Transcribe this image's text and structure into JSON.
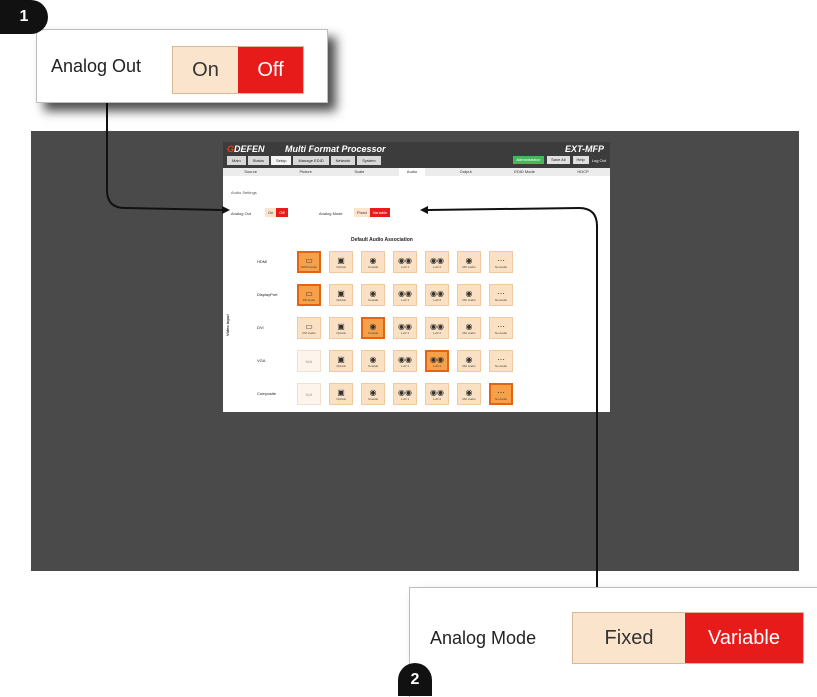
{
  "callouts": {
    "one": {
      "number": "1",
      "label": "Analog Out",
      "options": [
        "On",
        "Off"
      ],
      "selected": "Off"
    },
    "two": {
      "number": "2",
      "label": "Analog Mode",
      "options": [
        "Fixed",
        "Variable"
      ],
      "selected": "Variable"
    }
  },
  "app": {
    "logo_mark": "G",
    "logo": "DEFEN",
    "title": "Multi Format Processor",
    "model": "EXT-MFP",
    "tabs": [
      "Main",
      "Status",
      "Setup",
      "Manage EDID",
      "Network",
      "System"
    ],
    "active_tab": "Setup",
    "buttons": [
      "Administrator",
      "Save All",
      "Help"
    ],
    "user": "Log Out",
    "subtabs": [
      "Source",
      "Picture",
      "Scale",
      "Audio",
      "Output",
      "EDID Mode",
      "HDCP"
    ],
    "active_subtab": "Audio",
    "audio": {
      "section": "Audio Settings",
      "analog_out_label": "Analog Out",
      "analog_out_options": [
        "On",
        "Off"
      ],
      "analog_mode_label": "Analog Mode",
      "analog_mode_options": [
        "Fixed",
        "Variable"
      ]
    },
    "matrix": {
      "title": "Default Audio Association",
      "side_label": "Video Input",
      "rows": [
        {
          "label": "HDMI",
          "cells": [
            {
              "icon": "▭",
              "cap": "HDMI Audio",
              "state": "sel"
            },
            {
              "icon": "▣",
              "cap": "Optical",
              "state": ""
            },
            {
              "icon": "◉",
              "cap": "Coaxial",
              "state": ""
            },
            {
              "icon": "◉◉",
              "cap": "L+R 1",
              "state": ""
            },
            {
              "icon": "◉◉",
              "cap": "L+R 2",
              "state": ""
            },
            {
              "icon": "◉",
              "cap": "Mic Audio",
              "state": ""
            },
            {
              "icon": "⋯",
              "cap": "No Audio",
              "state": ""
            }
          ]
        },
        {
          "label": "DisplayPort",
          "cells": [
            {
              "icon": "▭",
              "cap": "DP Audio",
              "state": "sel"
            },
            {
              "icon": "▣",
              "cap": "Optical",
              "state": ""
            },
            {
              "icon": "◉",
              "cap": "Coaxial",
              "state": ""
            },
            {
              "icon": "◉◉",
              "cap": "L+R 1",
              "state": ""
            },
            {
              "icon": "◉◉",
              "cap": "L+R 2",
              "state": ""
            },
            {
              "icon": "◉",
              "cap": "Mic Audio",
              "state": ""
            },
            {
              "icon": "⋯",
              "cap": "No Audio",
              "state": ""
            }
          ]
        },
        {
          "label": "DVI",
          "cells": [
            {
              "icon": "▭",
              "cap": "DVI Audio",
              "state": ""
            },
            {
              "icon": "▣",
              "cap": "Optical",
              "state": ""
            },
            {
              "icon": "◉",
              "cap": "Coaxial",
              "state": "sel"
            },
            {
              "icon": "◉◉",
              "cap": "L+R 1",
              "state": ""
            },
            {
              "icon": "◉◉",
              "cap": "L+R 2",
              "state": ""
            },
            {
              "icon": "◉",
              "cap": "Mic Audio",
              "state": ""
            },
            {
              "icon": "⋯",
              "cap": "No Audio",
              "state": ""
            }
          ]
        },
        {
          "label": "VGA",
          "cells": [
            {
              "icon": "N/A",
              "cap": "",
              "state": "na"
            },
            {
              "icon": "▣",
              "cap": "Optical",
              "state": ""
            },
            {
              "icon": "◉",
              "cap": "Coaxial",
              "state": ""
            },
            {
              "icon": "◉◉",
              "cap": "L+R 1",
              "state": ""
            },
            {
              "icon": "◉◉",
              "cap": "L+R 2",
              "state": "sel"
            },
            {
              "icon": "◉",
              "cap": "Mic Audio",
              "state": ""
            },
            {
              "icon": "⋯",
              "cap": "No Audio",
              "state": ""
            }
          ]
        },
        {
          "label": "Composite",
          "cells": [
            {
              "icon": "N/A",
              "cap": "",
              "state": "na"
            },
            {
              "icon": "▣",
              "cap": "Optical",
              "state": ""
            },
            {
              "icon": "◉",
              "cap": "Coaxial",
              "state": ""
            },
            {
              "icon": "◉◉",
              "cap": "L+R 1",
              "state": ""
            },
            {
              "icon": "◉◉",
              "cap": "L+R 2",
              "state": ""
            },
            {
              "icon": "◉",
              "cap": "Mic Audio",
              "state": ""
            },
            {
              "icon": "⋯",
              "cap": "No Audio",
              "state": "sel"
            }
          ]
        }
      ]
    }
  },
  "colors": {
    "accent_red": "#e81b1b",
    "option_bg": "#fbe4cc",
    "backdrop": "#4a4a4a",
    "selected_cell": "#f7a04a"
  }
}
